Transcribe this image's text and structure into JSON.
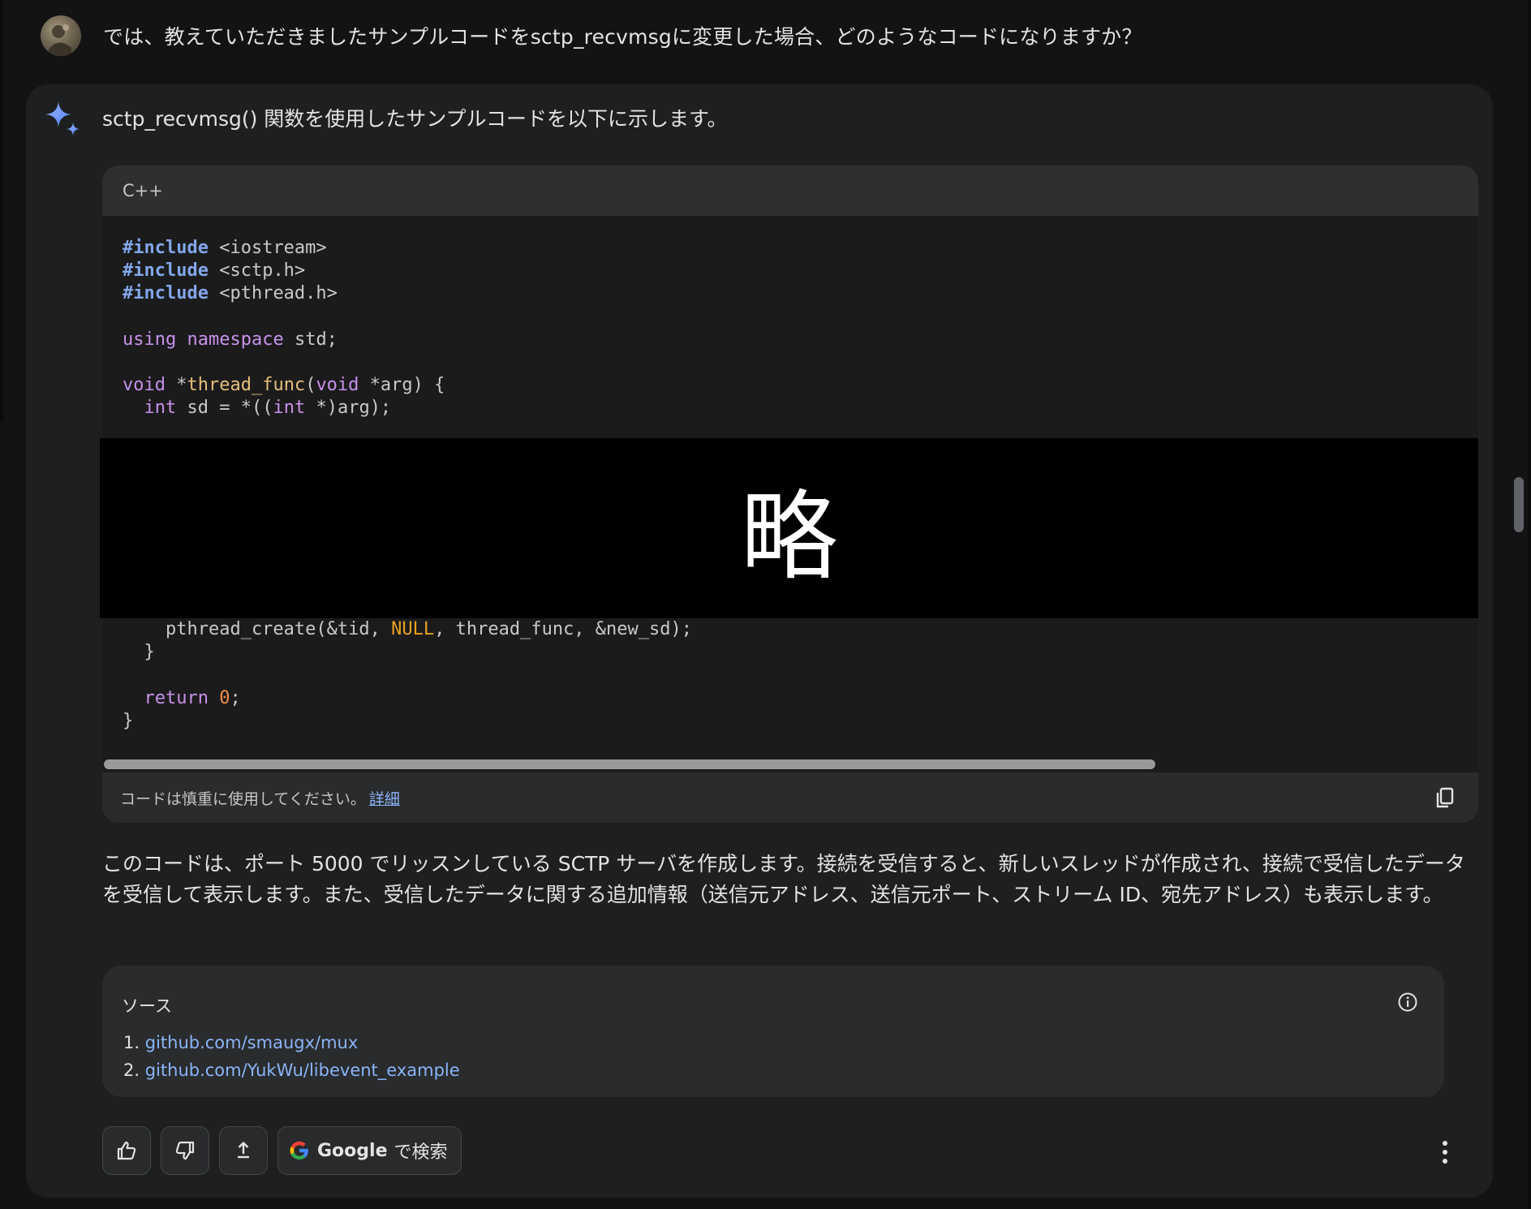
{
  "user_message": {
    "text": "では、教えていただきましたサンプルコードをsctp_recvmsgに変更した場合、どのようなコードになりますか？",
    "avatar_icon": "avatar"
  },
  "response": {
    "icon": "sparkle-icon",
    "intro": "sctp_recvmsg() 関数を使用したサンプルコードを以下に示します。",
    "code_block": {
      "language": "C++",
      "lines_top": [
        [
          {
            "t": "#include",
            "c": "kw-pre"
          },
          {
            "t": " <iostream>",
            "c": "str"
          }
        ],
        [
          {
            "t": "#include",
            "c": "kw-pre"
          },
          {
            "t": " <sctp.h>",
            "c": "str"
          }
        ],
        [
          {
            "t": "#include",
            "c": "kw-pre"
          },
          {
            "t": " <pthread.h>",
            "c": "str"
          }
        ],
        [],
        [
          {
            "t": "using",
            "c": "kw"
          },
          {
            "t": " ",
            "c": "str"
          },
          {
            "t": "namespace",
            "c": "kw"
          },
          {
            "t": " std;",
            "c": "str"
          }
        ],
        [],
        [
          {
            "t": "void",
            "c": "kw"
          },
          {
            "t": " *",
            "c": "str"
          },
          {
            "t": "thread_func",
            "c": "fn"
          },
          {
            "t": "(",
            "c": "str"
          },
          {
            "t": "void",
            "c": "kw"
          },
          {
            "t": " *arg) {",
            "c": "str"
          }
        ],
        [
          {
            "t": "  ",
            "c": "str"
          },
          {
            "t": "int",
            "c": "kw"
          },
          {
            "t": " sd = *((",
            "c": "str"
          },
          {
            "t": "int",
            "c": "kw"
          },
          {
            "t": " *)arg);",
            "c": "str"
          }
        ]
      ],
      "redaction_text": "略",
      "lines_bottom": [
        [
          {
            "t": "    pthread_create(&tid, ",
            "c": "str"
          },
          {
            "t": "NULL",
            "c": "lit"
          },
          {
            "t": ", thread_func, &new_sd);",
            "c": "str"
          }
        ],
        [
          {
            "t": "  }",
            "c": "str"
          }
        ],
        [],
        [
          {
            "t": "  ",
            "c": "str"
          },
          {
            "t": "return",
            "c": "kw"
          },
          {
            "t": " ",
            "c": "str"
          },
          {
            "t": "0",
            "c": "num"
          },
          {
            "t": ";",
            "c": "str"
          }
        ],
        [
          {
            "t": "}",
            "c": "str"
          }
        ]
      ],
      "footer_text": "コードは慎重に使用してください。",
      "footer_link": "詳細",
      "copy_icon": "copy-icon"
    },
    "explanation": "このコードは、ポート 5000 でリッスンしている SCTP サーバを作成します。接続を受信すると、新しいスレッドが作成され、接続で受信したデータを受信して表示します。また、受信したデータに関する追加情報（送信元アドレス、送信元ポート、ストリーム ID、宛先アドレス）も表示します。",
    "sources": {
      "title": "ソース",
      "items": [
        {
          "num": "1.",
          "link": "github.com/smaugx/mux"
        },
        {
          "num": "2.",
          "link": "github.com/YukWu/libevent_example"
        }
      ],
      "info_icon": "info-icon"
    },
    "actions": {
      "thumbs_up_icon": "thumbs-up-icon",
      "thumbs_down_icon": "thumbs-down-icon",
      "share_icon": "share-icon",
      "google_label": "Google",
      "google_suffix": "で検索",
      "more_icon": "more-vert-icon"
    }
  },
  "colors": {
    "background": "#131314",
    "card": "#1e1f20",
    "link": "#8ab4f8",
    "keyword": "#c792ea",
    "preprocessor": "#82a6e8",
    "function": "#e6c07b",
    "number": "#f08d49"
  }
}
